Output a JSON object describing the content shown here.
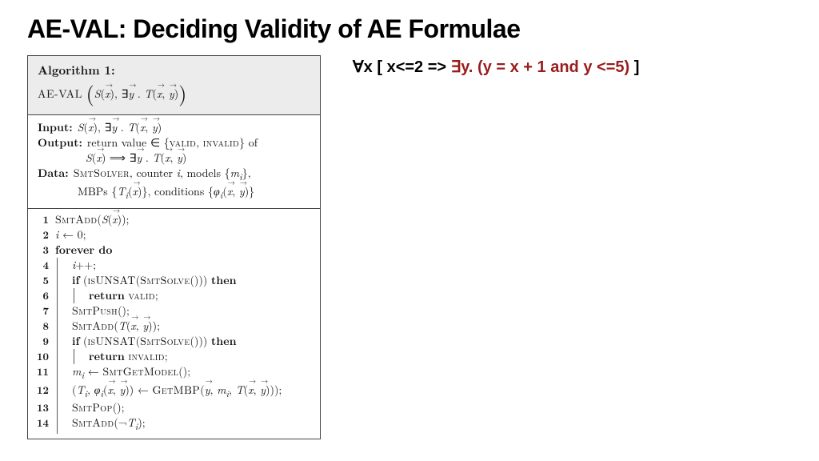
{
  "title": "AE-VAL: Deciding Validity of AE Formulae",
  "algorithm": {
    "label": "Algorithm 1:",
    "name": "AE-VAL",
    "signature_html": "<span class='bigparen'>(</span><span class='it'>S</span>(<span class='vec'>x</span>), ∃<span class='vec'>y</span> . <span class='it'>T</span>(<span class='vec'>x</span>, <span class='vec'>y</span>)<span class='bigparen'>)</span>",
    "input_key": "Input:",
    "input_html": "<span class='it'>S</span>(<span class='vec'>x</span>), ∃<span class='vec'>y</span> . <span class='it'>T</span>(<span class='vec'>x</span>, <span class='vec'>y</span>)",
    "output_key": "Output:",
    "output_l1_html": "return value ∈ {<span class='sc'>valid</span>, <span class='sc'>invalid</span>} of",
    "output_l2_html": "<span class='it'>S</span>(<span class='vec'>x</span>) ⟹ ∃<span class='vec'>y</span> . <span class='it'>T</span>(<span class='vec'>x</span>, <span class='vec'>y</span>)",
    "data_key": "Data:",
    "data_l1_html": "<span class='sc'>SmtSolver</span>, counter <span class='it'>i</span>, models {<span class='it'>m<sub>i</sub></span>},",
    "data_l2_html": "MBPs {<span class='it'>T<sub>i</sub></span>(<span class='vec'>x</span>)}, conditions {<span class='it'>φ<sub>i</sub></span>(<span class='vec'>x</span>, <span class='vec'>y</span>)}",
    "steps": [
      {
        "n": "1",
        "html": "<span class='sc'>SmtAdd</span>(<span class='it'>S</span>(<span class='vec'>x</span>));"
      },
      {
        "n": "2",
        "html": "<span class='it'>i</span> ← 0;"
      },
      {
        "n": "3",
        "html": "<span class='kw'>forever do</span>"
      },
      {
        "n": "4",
        "html": "<span class='ind1'><span class='it'>i</span>++;</span>"
      },
      {
        "n": "5",
        "html": "<span class='ind1'><span class='kw'>if</span> (<span class='sc'>isUNSAT</span>(<span class='sc'>SmtSolve</span>())) <span class='kw'>then</span></span>"
      },
      {
        "n": "6",
        "html": "<span class='ind1'><span class='ind2'><span class='kw'>return</span> <span class='sc'>valid</span>;</span></span>"
      },
      {
        "n": "7",
        "html": "<span class='ind1'><span class='sc'>SmtPush</span>();</span>"
      },
      {
        "n": "8",
        "html": "<span class='ind1'><span class='sc'>SmtAdd</span>(<span class='it'>T</span>(<span class='vec'>x</span>, <span class='vec'>y</span>));</span>"
      },
      {
        "n": "9",
        "html": "<span class='ind1'><span class='kw'>if</span> (<span class='sc'>isUNSAT</span>(<span class='sc'>SmtSolve</span>())) <span class='kw'>then</span></span>"
      },
      {
        "n": "10",
        "html": "<span class='ind1'><span class='ind2'><span class='kw'>return</span> <span class='sc'>invalid</span>;</span></span>"
      },
      {
        "n": "11",
        "html": "<span class='ind1'><span class='it'>m<sub>i</sub></span> ← <span class='sc'>SmtGetModel</span>();</span>"
      },
      {
        "n": "12",
        "html": "<span class='ind1'>(<span class='it'>T<sub>i</sub></span>, <span class='it'>φ<sub>i</sub></span>(<span class='vec'>x</span>, <span class='vec'>y</span>)) ← <span class='sc'>GetMBP</span>(<span class='vec'>y</span>, <span class='it'>m<sub>i</sub></span>, <span class='it'>T</span>(<span class='vec'>x</span>, <span class='vec'>y</span>)));</span>"
      },
      {
        "n": "13",
        "html": "<span class='ind1'><span class='sc'>SmtPop</span>();</span>"
      },
      {
        "n": "14",
        "html": "<span class='ind1'><span class='sc'>SmtAdd</span>(¬<span class='it'>T<sub>i</sub></span>);</span>"
      }
    ]
  },
  "formula": {
    "part1": "∀x [ x<=2 => ",
    "part2": "∃y. (y = x + 1 and y <=5)",
    "part3": " ]"
  }
}
